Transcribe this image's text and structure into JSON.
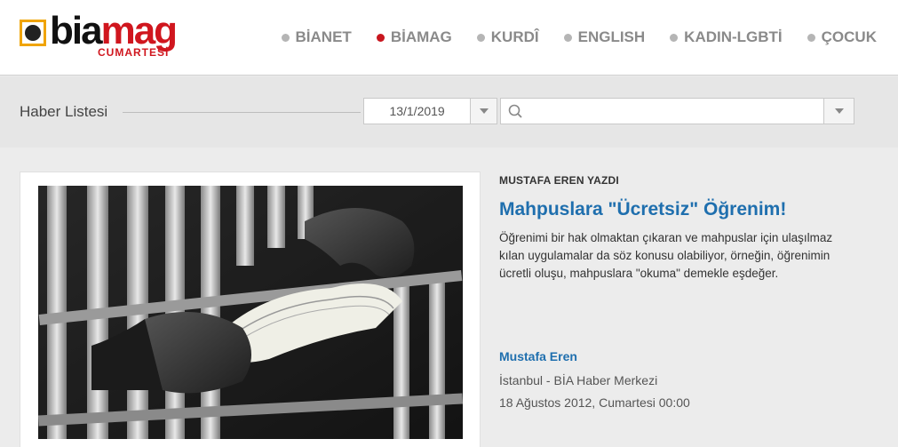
{
  "logo": {
    "part1": "bia",
    "part2": "mag",
    "subtitle": "CUMARTESİ"
  },
  "nav": [
    {
      "label": "BİANET",
      "active": false
    },
    {
      "label": "BİAMAG",
      "active": true
    },
    {
      "label": "KURDÎ",
      "active": false
    },
    {
      "label": "ENGLISH",
      "active": false
    },
    {
      "label": "KADIN-LGBTİ",
      "active": false
    },
    {
      "label": "ÇOCUK",
      "active": false
    }
  ],
  "toolbar": {
    "title": "Haber Listesi",
    "date_value": "13/1/2019",
    "search_value": ""
  },
  "article": {
    "kicker": "MUSTAFA EREN YAZDI",
    "headline": "Mahpuslara \"Ücretsiz\" Öğrenim!",
    "summary": "Öğrenimi bir hak olmaktan çıkaran ve mahpuslar için ulaşılmaz kılan uygulamalar da söz konusu olabiliyor, örneğin, öğrenimin ücretli oluşu, mahpuslara \"okuma\" demekle eşdeğer.",
    "author": "Mustafa Eren",
    "location": "İstanbul - BİA Haber Merkezi",
    "date": "18 Ağustos 2012, Cumartesi 00:00"
  },
  "colors": {
    "accent": "#d0161e",
    "link": "#1f6fae",
    "logo_ring": "#f0a400"
  }
}
